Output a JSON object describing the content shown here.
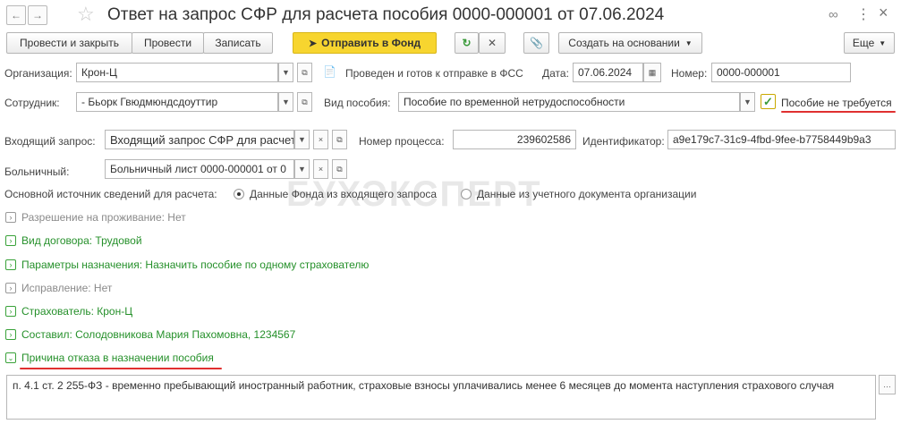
{
  "window": {
    "title": "Ответ на запрос СФР для расчета пособия 0000-000001 от 07.06.2024",
    "back_icon": "arrow-left-icon",
    "forward_icon": "arrow-right-icon",
    "favorite_icon": "star-icon",
    "link_icon": "link-icon",
    "more_icon": "kebab-icon",
    "close_icon": "close-icon"
  },
  "toolbar": {
    "post_and_close": "Провести и закрыть",
    "post": "Провести",
    "save": "Записать",
    "send_to_fund": "Отправить в Фонд",
    "create_based_on": "Создать на основании",
    "more": "Еще"
  },
  "form": {
    "organization_label": "Организация:",
    "organization_value": "Крон-Ц",
    "status_text": "Проведен и готов к отправке в ФСС",
    "date_label": "Дата:",
    "date_value": "07.06.2024",
    "number_label": "Номер:",
    "number_value": "0000-000001",
    "employee_label": "Сотрудник:",
    "employee_value": "- Бьорк Гвюдмюндсдоуттир",
    "benefit_type_label": "Вид пособия:",
    "benefit_type_value": "Пособие по временной нетрудоспособности",
    "benefit_not_required_label": "Пособие не требуется",
    "incoming_request_label": "Входящий запрос:",
    "incoming_request_value": "Входящий запрос СФР для расчет",
    "process_number_label": "Номер процесса:",
    "process_number_value": "239602586",
    "identifier_label": "Идентификатор:",
    "identifier_value": "a9e179c7-31c9-4fbd-9fee-b7758449b9a3",
    "sick_leave_label": "Больничный:",
    "sick_leave_value": "Больничный лист 0000-000001 от 0",
    "source_label": "Основной источник сведений для расчета:",
    "source_option_fund": "Данные Фонда из входящего запроса",
    "source_option_org": "Данные из учетного документа организации"
  },
  "sections": {
    "residence_permit": "Разрешение на проживание: Нет",
    "contract_type": "Вид договора: Трудовой",
    "assignment_params": "Параметры назначения: Назначить пособие по одному страхователю",
    "correction": "Исправление: Нет",
    "insurer": "Страхователь: Крон-Ц",
    "compiled_by": "Составил: Солодовникова Мария Пахомовна, 1234567",
    "refusal_reason": "Причина отказа в назначении пособия"
  },
  "refusal_text": "п. 4.1 ст. 2 255-ФЗ - временно пребывающий иностранный работник, страховые взносы уплачивались менее 6 месяцев до момента наступления страхового случая",
  "watermark": "БУХЭКСПЕРТ",
  "colors": {
    "accent_yellow": "#f7d52f",
    "section_green": "#25902a",
    "underline_red": "#e03030"
  }
}
